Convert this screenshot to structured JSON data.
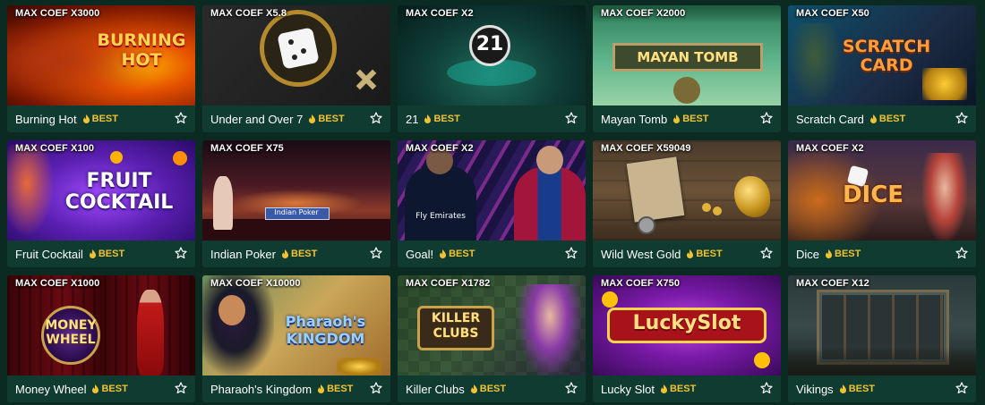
{
  "games": [
    {
      "name": "Burning Hot",
      "coef": "MAX COEF X3000",
      "badge": "BEST"
    },
    {
      "name": "Under and Over 7",
      "coef": "MAX COEF X5.8",
      "badge": "BEST"
    },
    {
      "name": "21",
      "coef": "MAX COEF X2",
      "badge": "BEST"
    },
    {
      "name": "Mayan Tomb",
      "coef": "MAX COEF X2000",
      "badge": "BEST"
    },
    {
      "name": "Scratch Card",
      "coef": "MAX COEF X50",
      "badge": "BEST"
    },
    {
      "name": "Fruit Cocktail",
      "coef": "MAX COEF X100",
      "badge": "BEST"
    },
    {
      "name": "Indian Poker",
      "coef": "MAX COEF X75",
      "badge": "BEST"
    },
    {
      "name": "Goal!",
      "coef": "MAX COEF X2",
      "badge": "BEST"
    },
    {
      "name": "Wild West Gold",
      "coef": "MAX COEF X59049",
      "badge": "BEST"
    },
    {
      "name": "Dice",
      "coef": "MAX COEF X2",
      "badge": "BEST"
    },
    {
      "name": "Money Wheel",
      "coef": "MAX COEF X1000",
      "badge": "BEST"
    },
    {
      "name": "Pharaoh's Kingdom",
      "coef": "MAX COEF X10000",
      "badge": "BEST"
    },
    {
      "name": "Killer Clubs",
      "coef": "MAX COEF X1782",
      "badge": "BEST"
    },
    {
      "name": "Lucky Slot",
      "coef": "MAX COEF X750",
      "badge": "BEST"
    },
    {
      "name": "Vikings",
      "coef": "MAX COEF X12",
      "badge": "BEST"
    }
  ],
  "thumb_logos": {
    "burning_hot": "BURNING HOT",
    "twentyone": "21",
    "mayan_tomb": "MAYAN TOMB",
    "scratch_card": "SCRATCH CARD",
    "fruit_cocktail": "FRUIT COCKTAIL",
    "indian_poker": "Indian Poker",
    "goal_sponsor": "Fly Emirates",
    "dice": "DICE",
    "money_wheel": "MONEY WHEEL",
    "pharaohs_kingdom": "Pharaoh's KINGDOM",
    "killer_clubs": "KILLER CLUBS",
    "lucky_slot": "LuckySlot"
  },
  "colors": {
    "page_bg": "#0b2a22",
    "card_footer": "#0f3b30",
    "badge": "#f1c232",
    "text": "#ffffff"
  },
  "icons": {
    "badge_icon": "flame-icon",
    "favorite_icon": "star-outline-icon"
  }
}
